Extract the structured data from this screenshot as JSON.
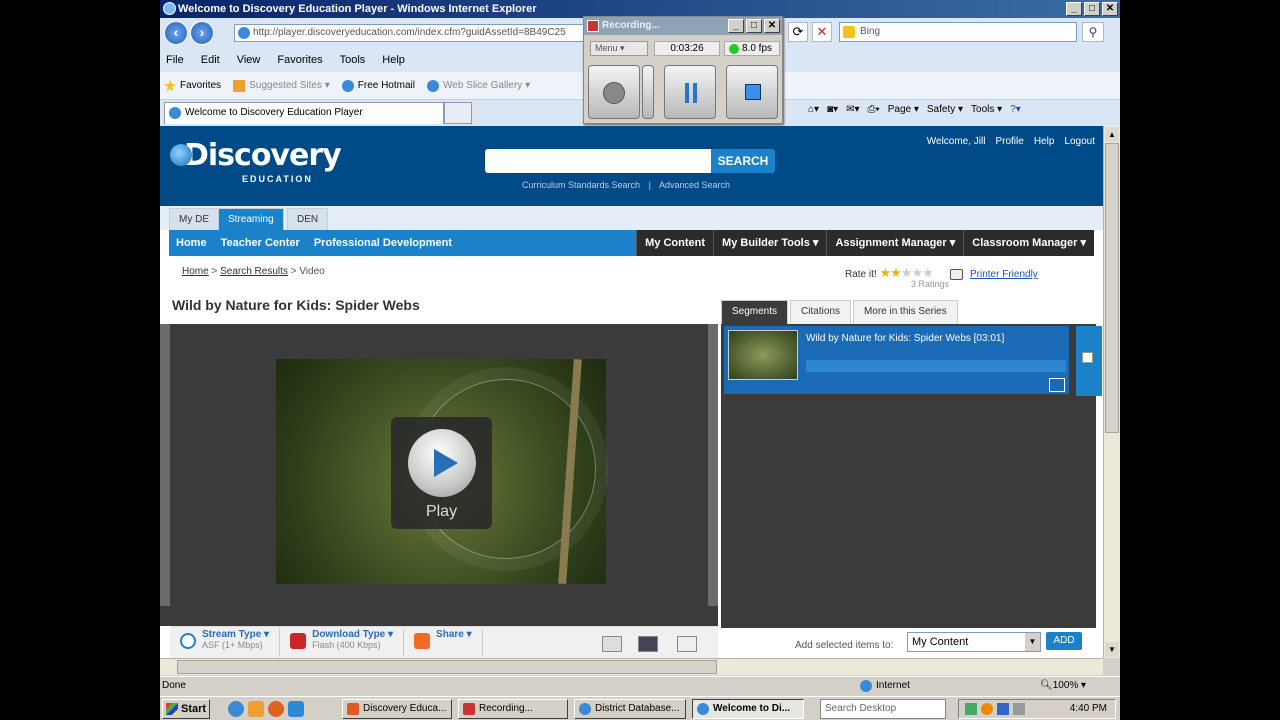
{
  "window": {
    "title": "Welcome to Discovery Education Player - Windows Internet Explorer",
    "min": "_",
    "max": "□",
    "close": "✕"
  },
  "browser": {
    "address": "http://player.discoveryeducation.com/index.cfm?guidAssetId=8B49C25",
    "search_placeholder": "Bing",
    "menu": [
      "File",
      "Edit",
      "View",
      "Favorites",
      "Tools",
      "Help"
    ],
    "favorites": [
      "Favorites",
      "Suggested Sites ▾",
      "Free Hotmail",
      "Web Slice Gallery ▾"
    ],
    "tab_title": "Welcome to Discovery Education Player",
    "commands": [
      "Page ▾",
      "Safety ▾",
      "Tools ▾"
    ],
    "status": "Done",
    "zone": "Internet",
    "zoom": "100%"
  },
  "recorder": {
    "title": "Recording...",
    "menu": "Menu",
    "time": "0:03:26",
    "fps": "8.0 fps"
  },
  "site": {
    "logo_main": "Discovery",
    "logo_sub": "EDUCATION",
    "search_button": "SEARCH",
    "search_link1": "Curriculum Standards Search",
    "search_sep": "|",
    "search_link2": "Advanced Search",
    "user": [
      "Welcome, Jill",
      "Profile",
      "Help",
      "Logout"
    ],
    "subtabs": [
      "My DE",
      "Streaming",
      "DEN"
    ],
    "nav_left": [
      "Home",
      "Teacher Center",
      "Professional Development"
    ],
    "nav_right": [
      "My Content",
      "My Builder Tools ▾",
      "Assignment Manager ▾",
      "Classroom Manager ▾"
    ],
    "crumbs": [
      "Home",
      "Search Results",
      "Video"
    ],
    "crumb_sep": ">",
    "rate_label": "Rate it!",
    "rating": 2,
    "rating_max": 5,
    "ratings_count": "3 Ratings",
    "printer": "Printer Friendly",
    "video_title": "Wild by Nature for Kids: Spider Webs",
    "play_label": "Play"
  },
  "player_tools": [
    {
      "label": "Stream Type ▾",
      "sub": "ASF (1+ Mbps)",
      "color": "#1b82c9"
    },
    {
      "label": "Download Type ▾",
      "sub": "Flash (400 Kbps)",
      "color": "#c62828"
    },
    {
      "label": "Share ▾",
      "sub": "",
      "color": "#f06b28"
    }
  ],
  "right_panel": {
    "tabs": [
      "Segments",
      "Citations",
      "More in this Series"
    ],
    "segment_title": "Wild by Nature for Kids: Spider Webs [03:01]",
    "add_label": "Add selected items to:",
    "add_select": "My Content",
    "add_button": "ADD"
  },
  "taskbar": {
    "start": "Start",
    "buttons": [
      "Discovery Educa...",
      "Recording...",
      "District Database...",
      "Welcome to Di..."
    ],
    "search_placeholder": "Search Desktop",
    "clock": "4:40 PM"
  }
}
